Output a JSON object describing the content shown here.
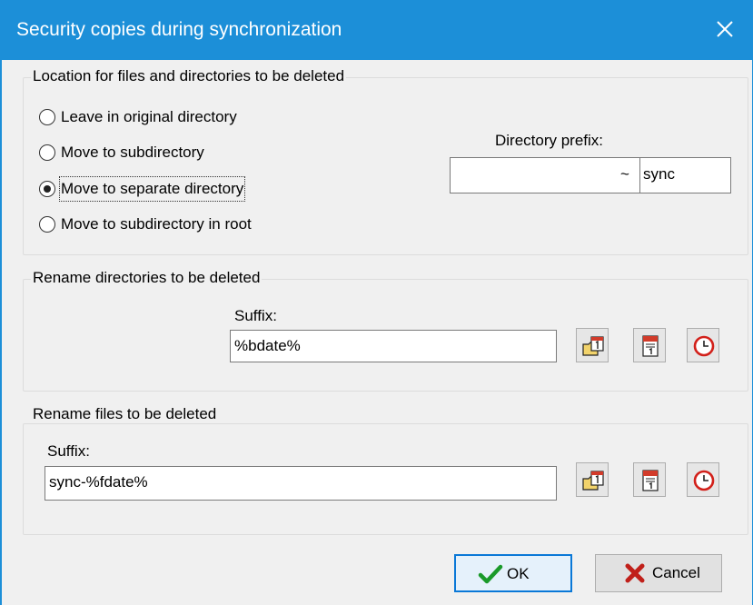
{
  "window": {
    "title": "Security copies during synchronization"
  },
  "location_group": {
    "legend": "Location for files and directories to be deleted",
    "options": [
      {
        "label": "Leave in original directory",
        "selected": false
      },
      {
        "label": "Move to subdirectory",
        "selected": false
      },
      {
        "label": "Move to separate directory",
        "selected": true
      },
      {
        "label": "Move to subdirectory in root",
        "selected": false
      }
    ],
    "prefix_label": "Directory prefix:",
    "prefix_left_value": "",
    "prefix_separator": "~",
    "prefix_value": "sync"
  },
  "rename_dirs_group": {
    "legend": "Rename directories to be deleted",
    "suffix_label": "Suffix:",
    "suffix_value": "%bdate%"
  },
  "rename_files_group": {
    "legend": "Rename files to be deleted",
    "suffix_label": "Suffix:",
    "suffix_value": "sync-%fdate%"
  },
  "icons": [
    "folder-calendar-icon",
    "calendar-icon",
    "clock-icon",
    "close-icon",
    "checkmark-icon",
    "x-mark-icon"
  ],
  "buttons": {
    "ok": "OK",
    "cancel": "Cancel"
  },
  "colors": {
    "titlebar": "#1c8fd8",
    "ok_border": "#0a78d7",
    "check_green": "#1a9a2a",
    "cancel_red": "#c0201a"
  }
}
